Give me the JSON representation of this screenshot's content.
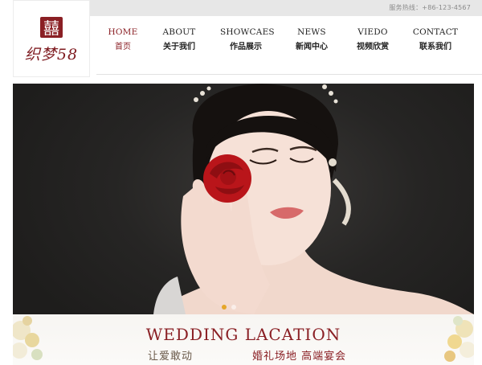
{
  "topbar": {
    "hotline": "服务热线：+86-123-4567"
  },
  "logo": {
    "badge_glyph": "囍",
    "text": "织梦58"
  },
  "nav": [
    {
      "en": "HOME",
      "cn": "首页",
      "active": true
    },
    {
      "en": "ABOUT",
      "cn": "关于我们",
      "active": false
    },
    {
      "en": "SHOWCAES",
      "cn": "作品展示",
      "active": false
    },
    {
      "en": "NEWS",
      "cn": "新闻中心",
      "active": false
    },
    {
      "en": "VIEDO",
      "cn": "视频欣赏",
      "active": false
    },
    {
      "en": "CONTACT",
      "cn": "联系我们",
      "active": false
    }
  ],
  "slider": {
    "total": 2,
    "current": 1
  },
  "banner": {
    "title": "WEDDING LACATION",
    "subtitle_left": "让爱敢动",
    "subtitle_right": "婚礼场地 高端宴会"
  },
  "colors": {
    "accent": "#8a1f24",
    "active_dot": "#e5a62a",
    "topbar": "#e7e7e7"
  }
}
